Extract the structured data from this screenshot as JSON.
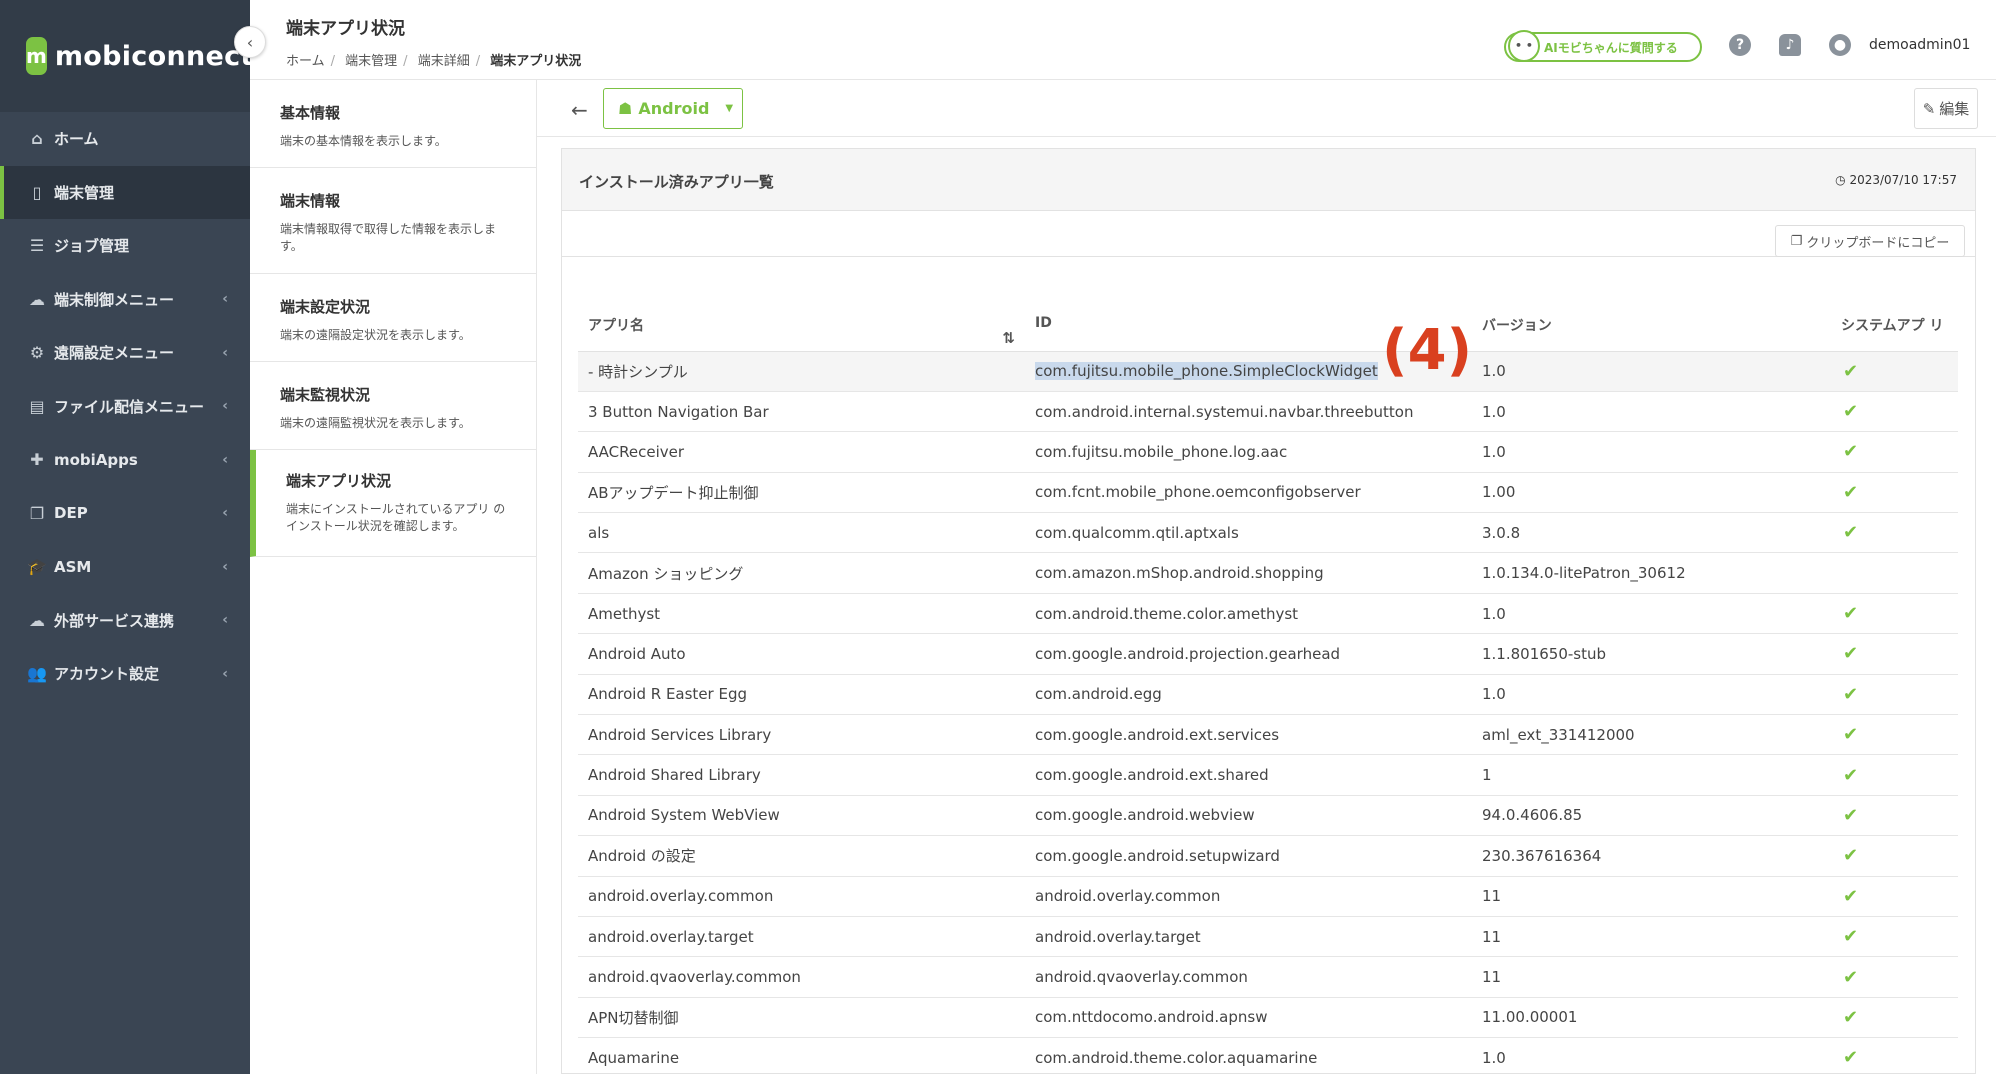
{
  "app": {
    "brand": "mobiconnect",
    "logo_letter": "m"
  },
  "sidebar": {
    "items": [
      {
        "label": "ホーム",
        "icon": "⌂",
        "chev": "",
        "active": false
      },
      {
        "label": "端末管理",
        "icon": "▯",
        "chev": "",
        "active": true
      },
      {
        "label": "ジョブ管理",
        "icon": "☰",
        "chev": "",
        "active": false
      },
      {
        "label": "端末制御メニュー",
        "icon": "☁",
        "chev": "‹",
        "active": false
      },
      {
        "label": "遠隔設定メニュー",
        "icon": "⚙",
        "chev": "‹",
        "active": false
      },
      {
        "label": "ファイル配信メニュー",
        "icon": "▤",
        "chev": "‹",
        "active": false
      },
      {
        "label": "mobiApps",
        "icon": "✚",
        "chev": "‹",
        "active": false
      },
      {
        "label": "DEP",
        "icon": "❐",
        "chev": "‹",
        "active": false
      },
      {
        "label": "ASM",
        "icon": "🎓",
        "chev": "‹",
        "active": false
      },
      {
        "label": "外部サービス連携",
        "icon": "☁",
        "chev": "‹",
        "active": false
      },
      {
        "label": "アカウント設定",
        "icon": "👥",
        "chev": "‹",
        "active": false
      }
    ]
  },
  "header": {
    "title": "端末アプリ状況",
    "breadcrumb": [
      "ホーム",
      "端末管理",
      "端末詳細",
      "端末アプリ状況"
    ],
    "ai_label": "AIモビちゃんに質問する",
    "username": "demoadmin01"
  },
  "subnav": [
    {
      "title": "基本情報",
      "desc": "端末の基本情報を表示します。"
    },
    {
      "title": "端末情報",
      "desc": "端末情報取得で取得した情報を表示しま す。"
    },
    {
      "title": "端末設定状況",
      "desc": "端末の遠隔設定状況を表示します。"
    },
    {
      "title": "端末監視状況",
      "desc": "端末の遠隔監視状況を表示します。"
    },
    {
      "title": "端末アプリ状況",
      "desc": "端末にインストールされているアプリ のインストール状況を確認します。"
    }
  ],
  "toolbar": {
    "os_label": "Android",
    "edit_label": "編集"
  },
  "panel": {
    "title": "インストール済みアプリ一覧",
    "timestamp": "2023/07/10 17:57",
    "copy_label": "クリップボードにコピー",
    "columns": [
      "アプリ名",
      "ID",
      "バージョン",
      "システムアプ リ"
    ],
    "rows": [
      {
        "name": "- 時計シンプル",
        "id": "com.fujitsu.mobile_phone.SimpleClockWidget",
        "version": "1.0",
        "system": true
      },
      {
        "name": "3 Button Navigation Bar",
        "id": "com.android.internal.systemui.navbar.threebutton",
        "version": "1.0",
        "system": true
      },
      {
        "name": "AACReceiver",
        "id": "com.fujitsu.mobile_phone.log.aac",
        "version": "1.0",
        "system": true
      },
      {
        "name": "ABアップデート抑止制御",
        "id": "com.fcnt.mobile_phone.oemconfigobserver",
        "version": "1.00",
        "system": true
      },
      {
        "name": "als",
        "id": "com.qualcomm.qtil.aptxals",
        "version": "3.0.8",
        "system": true
      },
      {
        "name": "Amazon ショッピング",
        "id": "com.amazon.mShop.android.shopping",
        "version": "1.0.134.0-litePatron_30612",
        "system": false
      },
      {
        "name": "Amethyst",
        "id": "com.android.theme.color.amethyst",
        "version": "1.0",
        "system": true
      },
      {
        "name": "Android Auto",
        "id": "com.google.android.projection.gearhead",
        "version": "1.1.801650-stub",
        "system": true
      },
      {
        "name": "Android R Easter Egg",
        "id": "com.android.egg",
        "version": "1.0",
        "system": true
      },
      {
        "name": "Android Services Library",
        "id": "com.google.android.ext.services",
        "version": "aml_ext_331412000",
        "system": true
      },
      {
        "name": "Android Shared Library",
        "id": "com.google.android.ext.shared",
        "version": "1",
        "system": true
      },
      {
        "name": "Android System WebView",
        "id": "com.google.android.webview",
        "version": "94.0.4606.85",
        "system": true
      },
      {
        "name": "Android の設定",
        "id": "com.google.android.setupwizard",
        "version": "230.367616364",
        "system": true
      },
      {
        "name": "android.overlay.common",
        "id": "android.overlay.common",
        "version": "11",
        "system": true
      },
      {
        "name": "android.overlay.target",
        "id": "android.overlay.target",
        "version": "11",
        "system": true
      },
      {
        "name": "android.qvaoverlay.common",
        "id": "android.qvaoverlay.common",
        "version": "11",
        "system": true
      },
      {
        "name": "APN切替制御",
        "id": "com.nttdocomo.android.apnsw",
        "version": "11.00.00001",
        "system": true
      },
      {
        "name": "Aquamarine",
        "id": "com.android.theme.color.aquamarine",
        "version": "1.0",
        "system": true
      }
    ]
  },
  "annotation": "(4)",
  "colors": {
    "accent": "#7cc243",
    "sidebar": "#3a4553",
    "annotation": "#d9401f"
  }
}
